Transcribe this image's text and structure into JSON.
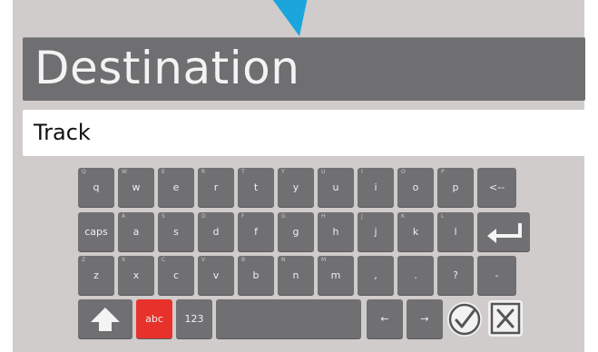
{
  "header": {
    "title": "Destination"
  },
  "input": {
    "value": "Track"
  },
  "keyboard": {
    "row1": [
      {
        "label": "q",
        "alt": "Q"
      },
      {
        "label": "w",
        "alt": "W"
      },
      {
        "label": "e",
        "alt": "E"
      },
      {
        "label": "r",
        "alt": "R"
      },
      {
        "label": "t",
        "alt": "T"
      },
      {
        "label": "y",
        "alt": "Y"
      },
      {
        "label": "u",
        "alt": "U"
      },
      {
        "label": "i",
        "alt": "I"
      },
      {
        "label": "o",
        "alt": "O"
      },
      {
        "label": "p",
        "alt": "P"
      },
      {
        "label": "<--",
        "alt": ""
      }
    ],
    "row2": [
      {
        "label": "caps",
        "alt": ""
      },
      {
        "label": "a",
        "alt": "A"
      },
      {
        "label": "s",
        "alt": "S"
      },
      {
        "label": "d",
        "alt": "D"
      },
      {
        "label": "f",
        "alt": "F"
      },
      {
        "label": "g",
        "alt": "G"
      },
      {
        "label": "h",
        "alt": "H"
      },
      {
        "label": "j",
        "alt": "J"
      },
      {
        "label": "k",
        "alt": "K"
      },
      {
        "label": "l",
        "alt": "L"
      }
    ],
    "row3": [
      {
        "label": "z",
        "alt": "Z"
      },
      {
        "label": "x",
        "alt": "X"
      },
      {
        "label": "c",
        "alt": "C"
      },
      {
        "label": "v",
        "alt": "V"
      },
      {
        "label": "b",
        "alt": "B"
      },
      {
        "label": "n",
        "alt": "N"
      },
      {
        "label": "m",
        "alt": "M"
      },
      {
        "label": ",",
        "alt": ""
      },
      {
        "label": ".",
        "alt": ""
      },
      {
        "label": "?",
        "alt": ""
      },
      {
        "label": "-",
        "alt": ""
      }
    ],
    "bottom": {
      "abc_label": "abc",
      "num_label": "123",
      "left_label": "←",
      "right_label": "→"
    }
  },
  "icons": {
    "top": "navigation-arrow-icon",
    "enter": "enter-icon",
    "shift": "shift-icon",
    "confirm": "checkmark-icon",
    "cancel": "cancel-icon"
  },
  "colors": {
    "background": "#cfcccb",
    "key": "#706f71",
    "accent_red": "#e8312b",
    "arrow_blue": "#1aa6dd"
  }
}
